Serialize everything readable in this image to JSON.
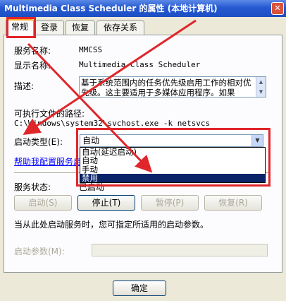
{
  "window": {
    "title": "Multimedia Class Scheduler 的属性 (本地计算机)",
    "close_label": "✕"
  },
  "tabs": [
    {
      "label": "常规",
      "active": true
    },
    {
      "label": "登录",
      "active": false
    },
    {
      "label": "恢复",
      "active": false
    },
    {
      "label": "依存关系",
      "active": false
    }
  ],
  "general": {
    "service_name_label": "服务名称:",
    "service_name_value": "MMCSS",
    "display_name_label": "显示名称:",
    "display_name_value": "Multimedia Class Scheduler",
    "description_label": "描述:",
    "description_value": "基于系统范围内的任务优先级启用工作的相对优先级。这主要适用于多媒体应用程序。如果",
    "exe_path_label": "可执行文件的路径:",
    "exe_path_value": "C:\\Windows\\system32\\svchost.exe -k netsvcs",
    "startup_type_label": "启动类型(E):",
    "startup_type_value": "自动",
    "startup_options": [
      "自动(延迟启动)",
      "自动",
      "手动",
      "禁用"
    ],
    "selected_option_index": 3,
    "help_link": "帮助我配置服务启动选项",
    "service_status_label": "服务状态:",
    "service_status_value": "已启动"
  },
  "buttons": {
    "start": "启动(S)",
    "stop": "停止(T)",
    "pause": "暂停(P)",
    "resume": "恢复(R)"
  },
  "hint_text": "当从此处启动服务时，您可指定所适用的启动参数。",
  "start_params_label": "启动参数(M):",
  "ok_label": "确定",
  "annotation_color": "#e0262b"
}
